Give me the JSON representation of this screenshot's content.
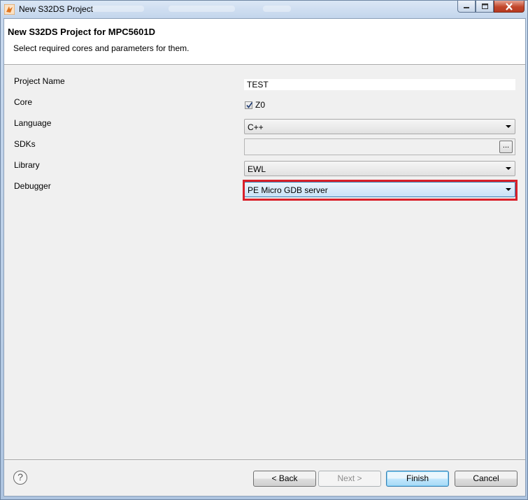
{
  "window": {
    "title": "New S32DS Project",
    "accent_close": "#c2462b"
  },
  "header": {
    "title": "New S32DS Project for MPC5601D",
    "description": "Select required cores and parameters for them."
  },
  "form": {
    "project_name": {
      "label": "Project Name",
      "value": "TEST"
    },
    "core": {
      "label": "Core",
      "option_label": "Z0",
      "checked": true
    },
    "language": {
      "label": "Language",
      "value": "C++"
    },
    "sdks": {
      "label": "SDKs",
      "value": "",
      "browse_label": "..."
    },
    "library": {
      "label": "Library",
      "value": "EWL"
    },
    "debugger": {
      "label": "Debugger",
      "value": "PE Micro GDB server",
      "highlight_color": "#d9202a"
    }
  },
  "footer": {
    "help_symbol": "?",
    "back_label": "< Back",
    "next_label": "Next >",
    "finish_label": "Finish",
    "cancel_label": "Cancel"
  }
}
